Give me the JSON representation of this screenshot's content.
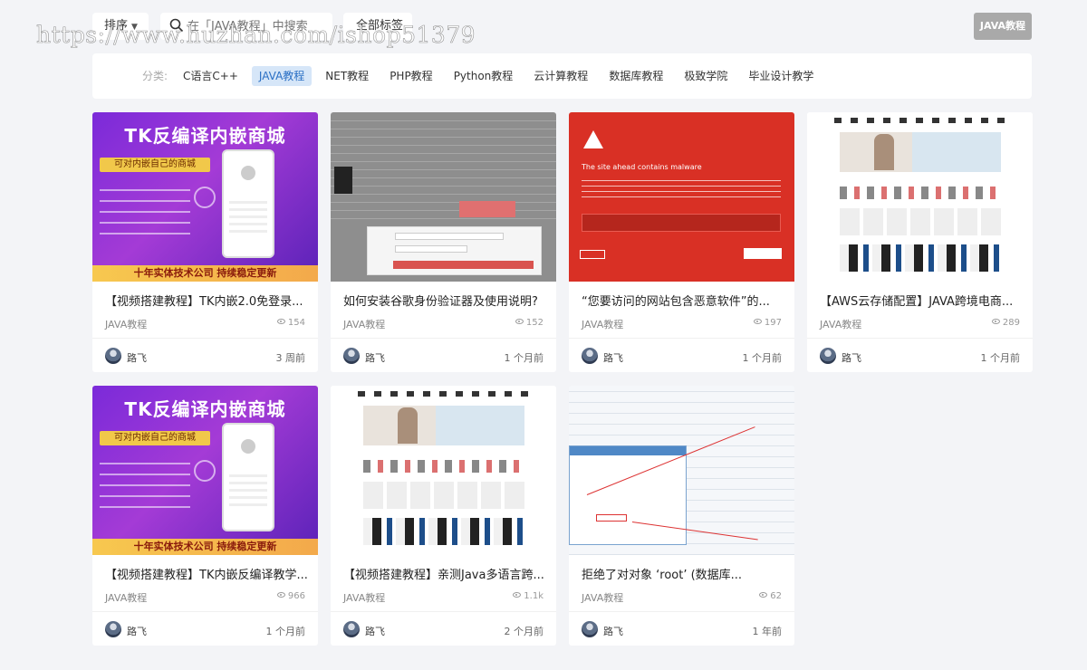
{
  "watermark": "https://www.huzhan.com/ishop51379",
  "toolbar": {
    "sort_label": "排序",
    "search_placeholder": "在「JAVA教程」中搜索",
    "all_tags_label": "全部标签",
    "current_tag": "JAVA教程"
  },
  "categories": {
    "label": "分类:",
    "items": [
      "C语言C++",
      "JAVA教程",
      "NET教程",
      "PHP教程",
      "Python教程",
      "云计算教程",
      "数据库教程",
      "极致学院",
      "毕业设计教学"
    ],
    "active": "JAVA教程"
  },
  "cards": [
    {
      "title": "【视频搭建教程】TK内嵌2.0免登录...",
      "category": "JAVA教程",
      "views": "154",
      "author": "路飞",
      "time": "3 周前",
      "thumb": "purple",
      "thumb_heading": "TK反编译内嵌商城",
      "thumb_badge": "可对内嵌自己的商城",
      "thumb_banner": "十年实体技术公司 持续稳定更新"
    },
    {
      "title": "如何安装谷歌身份验证器及使用说明?",
      "category": "JAVA教程",
      "views": "152",
      "author": "路飞",
      "time": "1 个月前",
      "thumb": "grey"
    },
    {
      "title": "“您要访问的网站包含恶意软件”的...",
      "category": "JAVA教程",
      "views": "197",
      "author": "路飞",
      "time": "1 个月前",
      "thumb": "red",
      "thumb_heading": "The site ahead contains malware"
    },
    {
      "title": "【AWS云存储配置】JAVA跨境电商...",
      "category": "JAVA教程",
      "views": "289",
      "author": "路飞",
      "time": "1 个月前",
      "thumb": "shop"
    },
    {
      "title": "【视频搭建教程】TK内嵌反编译教学...",
      "category": "JAVA教程",
      "views": "966",
      "author": "路飞",
      "time": "1 个月前",
      "thumb": "purple",
      "thumb_heading": "TK反编译内嵌商城",
      "thumb_badge": "可对内嵌自己的商城",
      "thumb_banner": "十年实体技术公司 持续稳定更新"
    },
    {
      "title": "【视频搭建教程】亲测Java多语言跨...",
      "category": "JAVA教程",
      "views": "1.1k",
      "author": "路飞",
      "time": "2 个月前",
      "thumb": "shop"
    },
    {
      "title": "拒绝了对对象 ‘root’ (数据库...",
      "category": "JAVA教程",
      "views": "62",
      "author": "路飞",
      "time": "1 年前",
      "thumb": "win"
    }
  ]
}
